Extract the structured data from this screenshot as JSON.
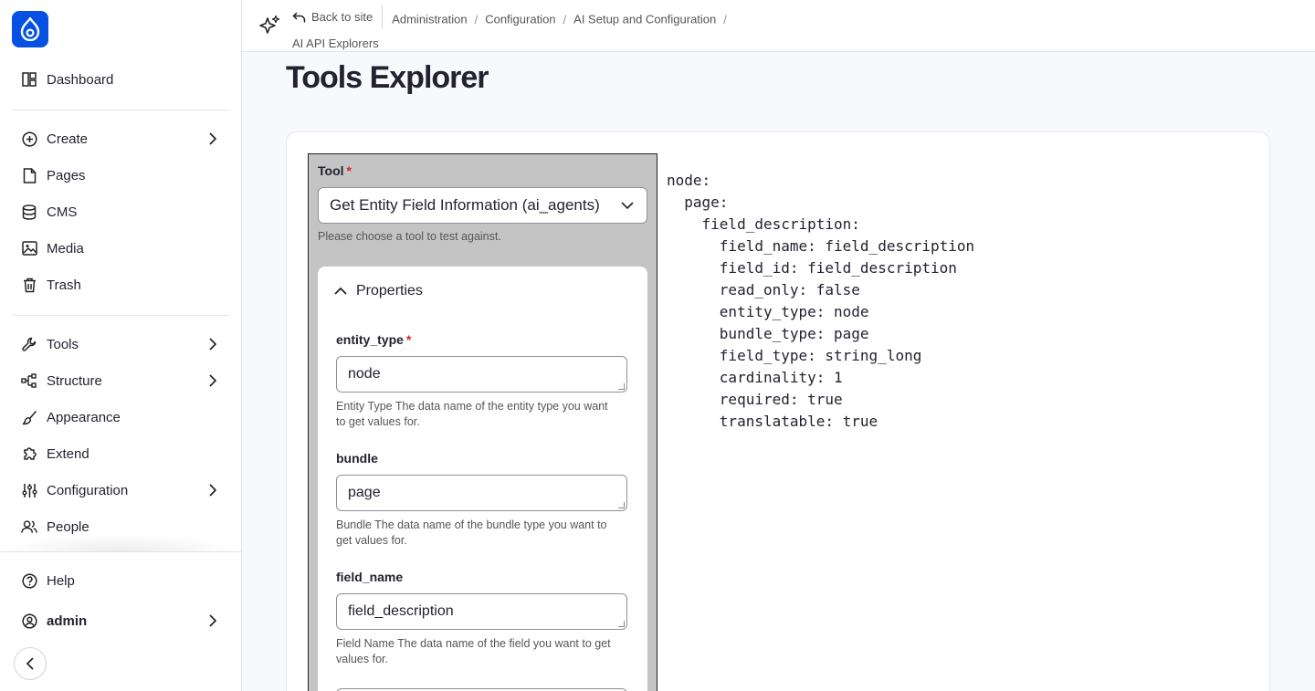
{
  "sidebar": {
    "logo_icon": "drupal-drop-icon",
    "dashboard": "Dashboard",
    "items": [
      {
        "label": "Create",
        "icon": "plus-circle-icon"
      },
      {
        "label": "Pages",
        "icon": "file-icon"
      },
      {
        "label": "CMS",
        "icon": "database-icon"
      },
      {
        "label": "Media",
        "icon": "image-icon"
      },
      {
        "label": "Trash",
        "icon": "trash-icon"
      },
      {
        "label": "Tools",
        "icon": "wrench-icon"
      },
      {
        "label": "Structure",
        "icon": "structure-icon"
      },
      {
        "label": "Appearance",
        "icon": "brush-icon"
      },
      {
        "label": "Extend",
        "icon": "puzzle-icon"
      },
      {
        "label": "Configuration",
        "icon": "sliders-icon"
      },
      {
        "label": "People",
        "icon": "people-icon"
      }
    ],
    "help": "Help",
    "user": "admin"
  },
  "breadcrumb": {
    "back": "Back to site",
    "items": [
      "Administration",
      "Configuration",
      "AI Setup and Configuration",
      "AI API Explorers"
    ]
  },
  "page": {
    "title": "Tools Explorer"
  },
  "form": {
    "tool_label": "Tool",
    "tool_value": "Get Entity Field Information (ai_agents)",
    "tool_help": "Please choose a tool to test against.",
    "properties_label": "Properties",
    "fields": [
      {
        "label": "entity_type",
        "value": "node",
        "required": true,
        "help": "Entity Type The data name of the entity type you want to get values for."
      },
      {
        "label": "bundle",
        "value": "page",
        "required": false,
        "help": "Bundle The data name of the bundle type you want to get values for."
      },
      {
        "label": "field_name",
        "value": "field_description",
        "required": false,
        "help": "Field Name The data name of the field you want to get values for."
      }
    ]
  },
  "output": {
    "yaml": "node:\n  page:\n    field_description:\n      field_name: field_description\n      field_id: field_description\n      read_only: false\n      entity_type: node\n      bundle_type: page\n      field_type: string_long\n      cardinality: 1\n      required: true\n      translatable: true"
  },
  "colors": {
    "brand": "#0551e3",
    "required": "#dc2323"
  }
}
